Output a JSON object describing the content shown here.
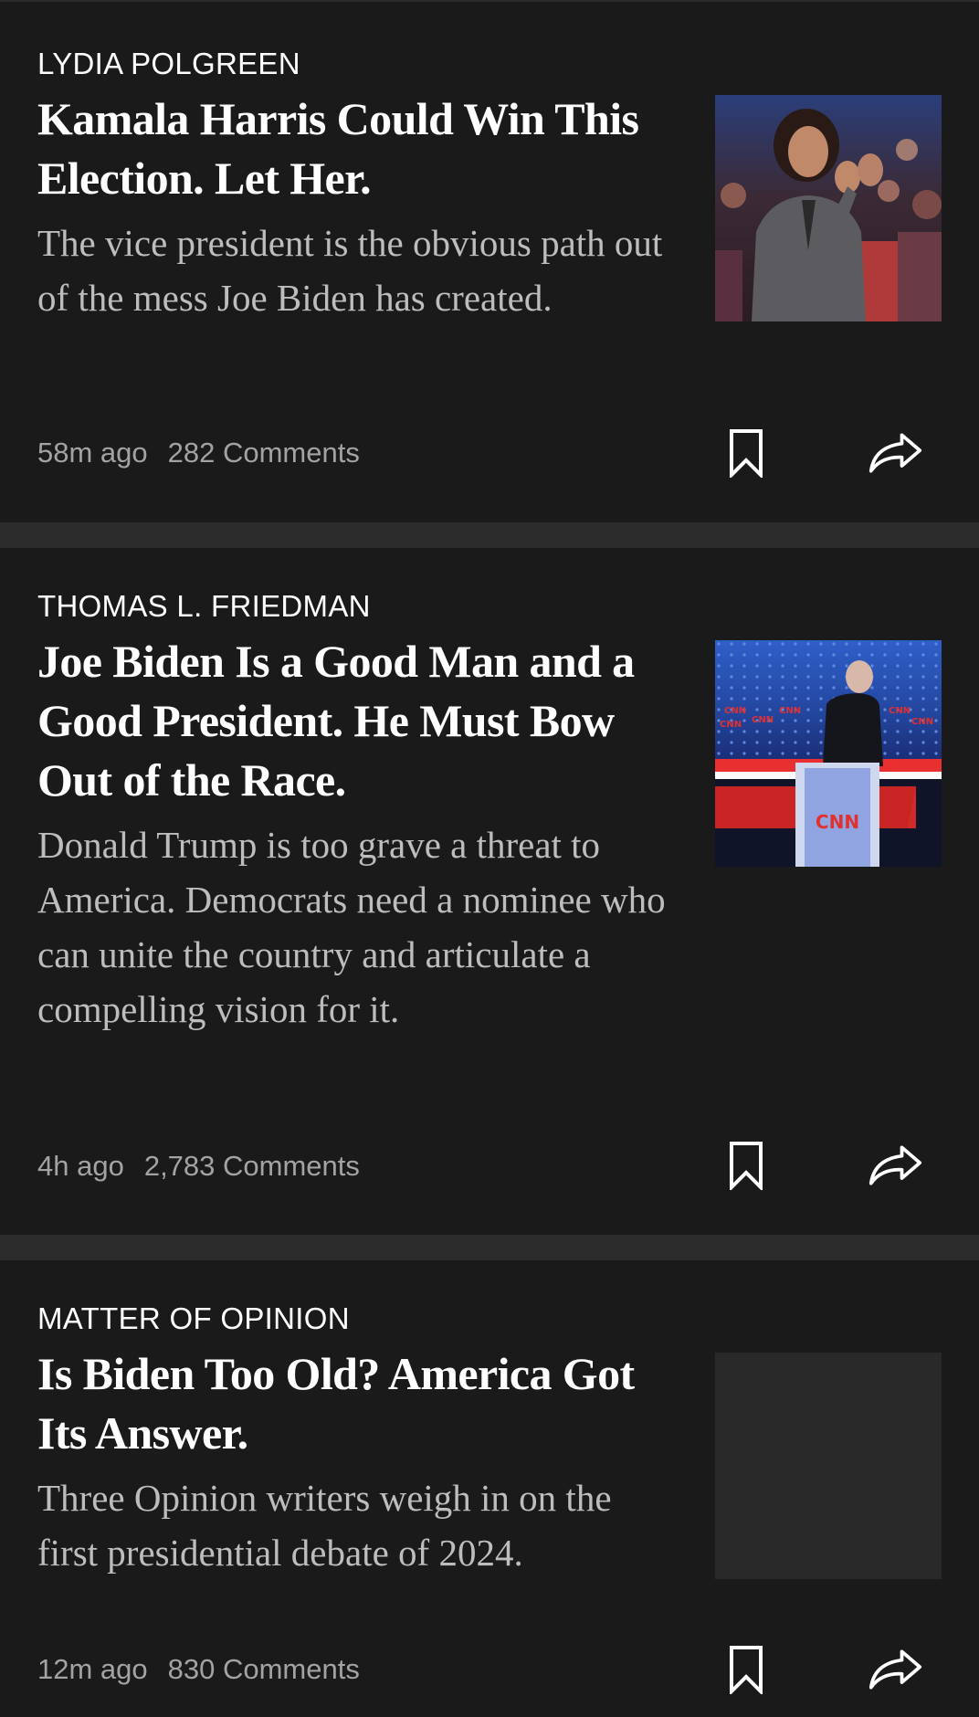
{
  "theme": {
    "background": "#1a1a1a",
    "divider": "#2c2c2c",
    "headline_color": "#ffffff",
    "summary_color": "#bdbdbd",
    "meta_color": "#a3a3a3"
  },
  "articles": [
    {
      "kicker": "LYDIA POLGREEN",
      "headline": "Kamala Harris Could Win This Election. Let Her.",
      "summary": "The vice president is the obvious path out of the mess Joe Biden has created.",
      "time": "58m ago",
      "comments": "282 Comments",
      "thumbnail": "photo-woman-clapping-at-rally",
      "save_icon": "bookmark-icon",
      "share_icon": "share-arrow-icon"
    },
    {
      "kicker": "THOMAS L. FRIEDMAN",
      "headline": "Joe Biden Is a Good Man and a Good President. He Must Bow Out of the Race.",
      "summary": "Donald Trump is too grave a threat to America. Democrats need a nominee who can unite the country and articulate a compelling vision for it.",
      "time": "4h ago",
      "comments": "2,783 Comments",
      "thumbnail": "photo-man-at-debate-podium",
      "podium_logo": "CNN",
      "save_icon": "bookmark-icon",
      "share_icon": "share-arrow-icon"
    },
    {
      "kicker": "MATTER OF OPINION",
      "headline": "Is Biden Too Old? America Got Its Answer.",
      "summary": "Three Opinion writers weigh in on the first presidential debate of 2024.",
      "time": "12m ago",
      "comments": "830 Comments",
      "thumbnail": "image-placeholder",
      "save_icon": "bookmark-icon",
      "share_icon": "share-arrow-icon"
    }
  ]
}
